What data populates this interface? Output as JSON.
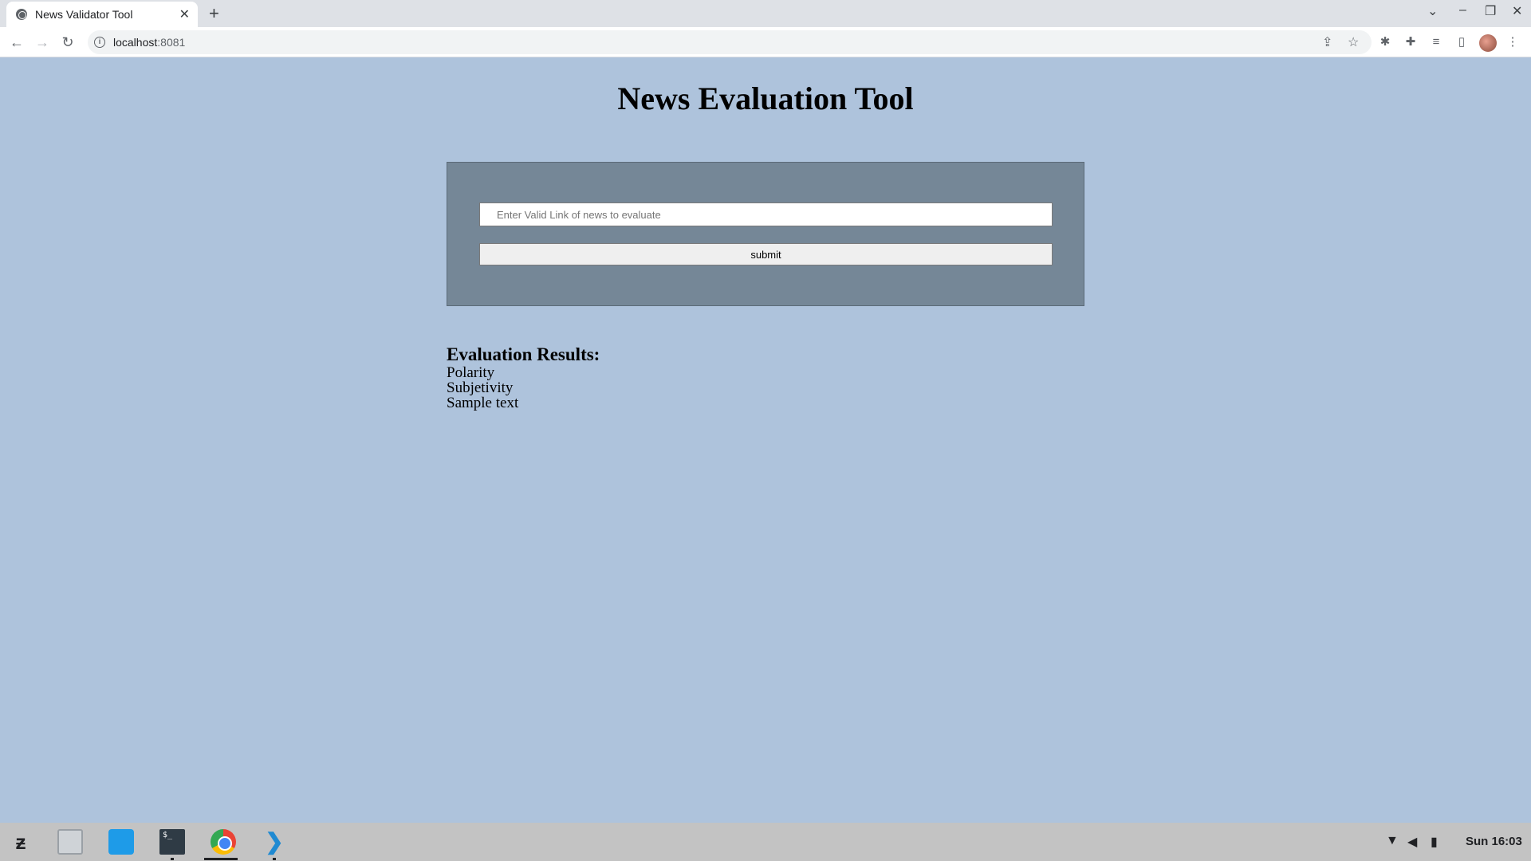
{
  "browser": {
    "tab_title": "News Validator Tool",
    "tab_close_glyph": "✕",
    "new_tab_glyph": "+",
    "url_host": "localhost",
    "url_port": ":8081",
    "icons": [
      "back-icon",
      "forward-icon",
      "reload-icon",
      "share-icon",
      "star-icon",
      "extension-icon",
      "puzzle-icon",
      "media-icon",
      "sidepanel-icon",
      "menu-icon"
    ]
  },
  "page": {
    "title": "News Evaluation Tool",
    "input_placeholder": "Enter Valid Link of news to evaluate",
    "submit_label": "submit",
    "results_heading": "Evaluation Results:",
    "results": {
      "polarity": "Polarity",
      "subjectivity": "Subjetivity",
      "text": "Sample text"
    }
  },
  "taskbar": {
    "apps": [
      "launcher",
      "files",
      "store",
      "terminal",
      "chrome",
      "vscode"
    ],
    "clock": "Sun 16:03"
  },
  "colors": {
    "page_bg": "#aec3dc",
    "panel_bg": "#758797"
  }
}
